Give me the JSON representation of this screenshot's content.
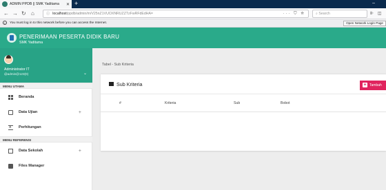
{
  "browser": {
    "tab_title": "ADMIN PPDB || SMK Yaditama",
    "tab_close": "✕",
    "new_tab": "+",
    "window_min": "–",
    "url_host": "localhost",
    "url_path": "/ppdb/admin/m/V25nZ1VUOXNRUZZTzFwRFdEdHA=",
    "url_actions": "··· ⛉ ☆",
    "search_placeholder": "Search",
    "right_icons": "⊪ ◫ ≡",
    "notice_text": "You must log in to this network before you can access the Internet.",
    "notice_button": "Open Network Login Page"
  },
  "header": {
    "title": "PENERIMAAN PESERTA DIDIK BARU",
    "subtitle": "SMK Yaditama"
  },
  "user": {
    "name": "Administrator IT",
    "email": "@admin@123(0)",
    "chevron": "⌄"
  },
  "sidebar": {
    "section_main": "MENU UTAMA",
    "section_ref": "MENU REFERENSI",
    "items": [
      {
        "label": "Beranda"
      },
      {
        "label": "Data Ujian",
        "plus": "+"
      },
      {
        "label": "Perhitungan"
      },
      {
        "label": "Data Sekolah",
        "plus": "+"
      },
      {
        "label": "Files Manager"
      }
    ]
  },
  "content": {
    "breadcrumb": "Tabel - Sub Kriteria",
    "card_title": "Sub Kriteria",
    "add_button": "Tambah",
    "add_plus": "+",
    "columns": [
      "#",
      "Kriteria",
      "Sub",
      "Bobot"
    ]
  },
  "colors": {
    "brand": "#2aaa8a",
    "add_button": "#e0245e"
  }
}
